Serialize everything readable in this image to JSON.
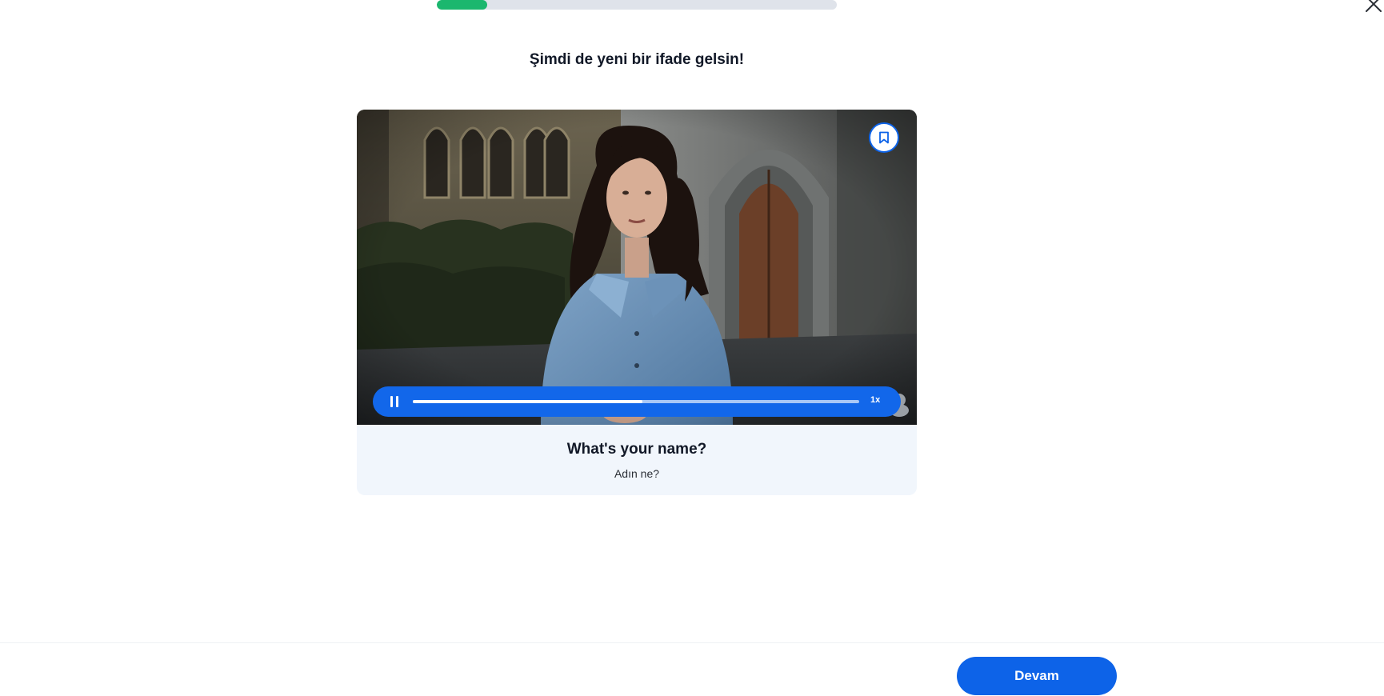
{
  "lesson": {
    "progress_fraction": 0.125
  },
  "prompt": {
    "title": "Şimdi de yeni bir ifade gelsin!"
  },
  "video": {
    "playback_fraction": 0.515,
    "speed_label": "1x",
    "state": "playing"
  },
  "phrase": {
    "text": "What's your name?",
    "translation": "Adın ne?"
  },
  "footer": {
    "continue_label": "Devam"
  },
  "icons": {
    "close": "close-icon",
    "bookmark": "bookmark-icon",
    "pause": "pause-icon"
  },
  "colors": {
    "primary": "#0d63e8",
    "progress": "#1bb76e",
    "track": "#dfe3ea",
    "card": "#f1f6fc"
  }
}
